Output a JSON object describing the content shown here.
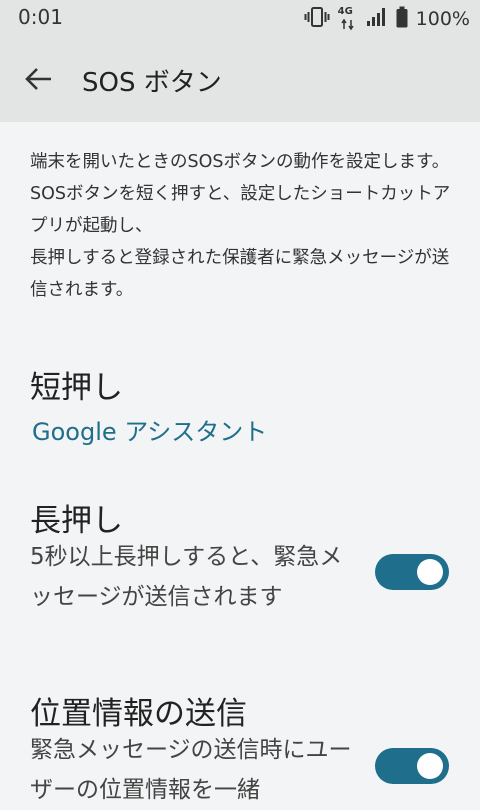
{
  "status_bar": {
    "time": "0:01",
    "network_label": "4G",
    "battery_text": "100%",
    "icons": [
      "vibrate-icon",
      "4g-icon",
      "signal-icon",
      "battery-icon"
    ]
  },
  "app_bar": {
    "title": "SOS ボタン",
    "back_icon": "arrow-left-icon"
  },
  "description": [
    "端末を開いたときのSOSボタンの動作を設定します。",
    "SOSボタンを短く押すと、設定したショートカットアプリが起動し、",
    "長押しすると登録された保護者に緊急メッセージが送信されます。"
  ],
  "short_press": {
    "title": "短押し",
    "value": "Google アシスタント"
  },
  "long_press": {
    "title": "長押し",
    "summary": "5秒以上長押しすると、緊急メッセージが送信されます",
    "enabled": true
  },
  "location": {
    "title": "位置情報の送信",
    "summary": "緊急メッセージの送信時にユーザーの位置情報を一緒",
    "enabled": true
  },
  "colors": {
    "accent": "#1f6e8c",
    "toggle_knob": "#ffffff",
    "bar_background": "#e3e4e4",
    "page_background": "#f2f4f5"
  }
}
